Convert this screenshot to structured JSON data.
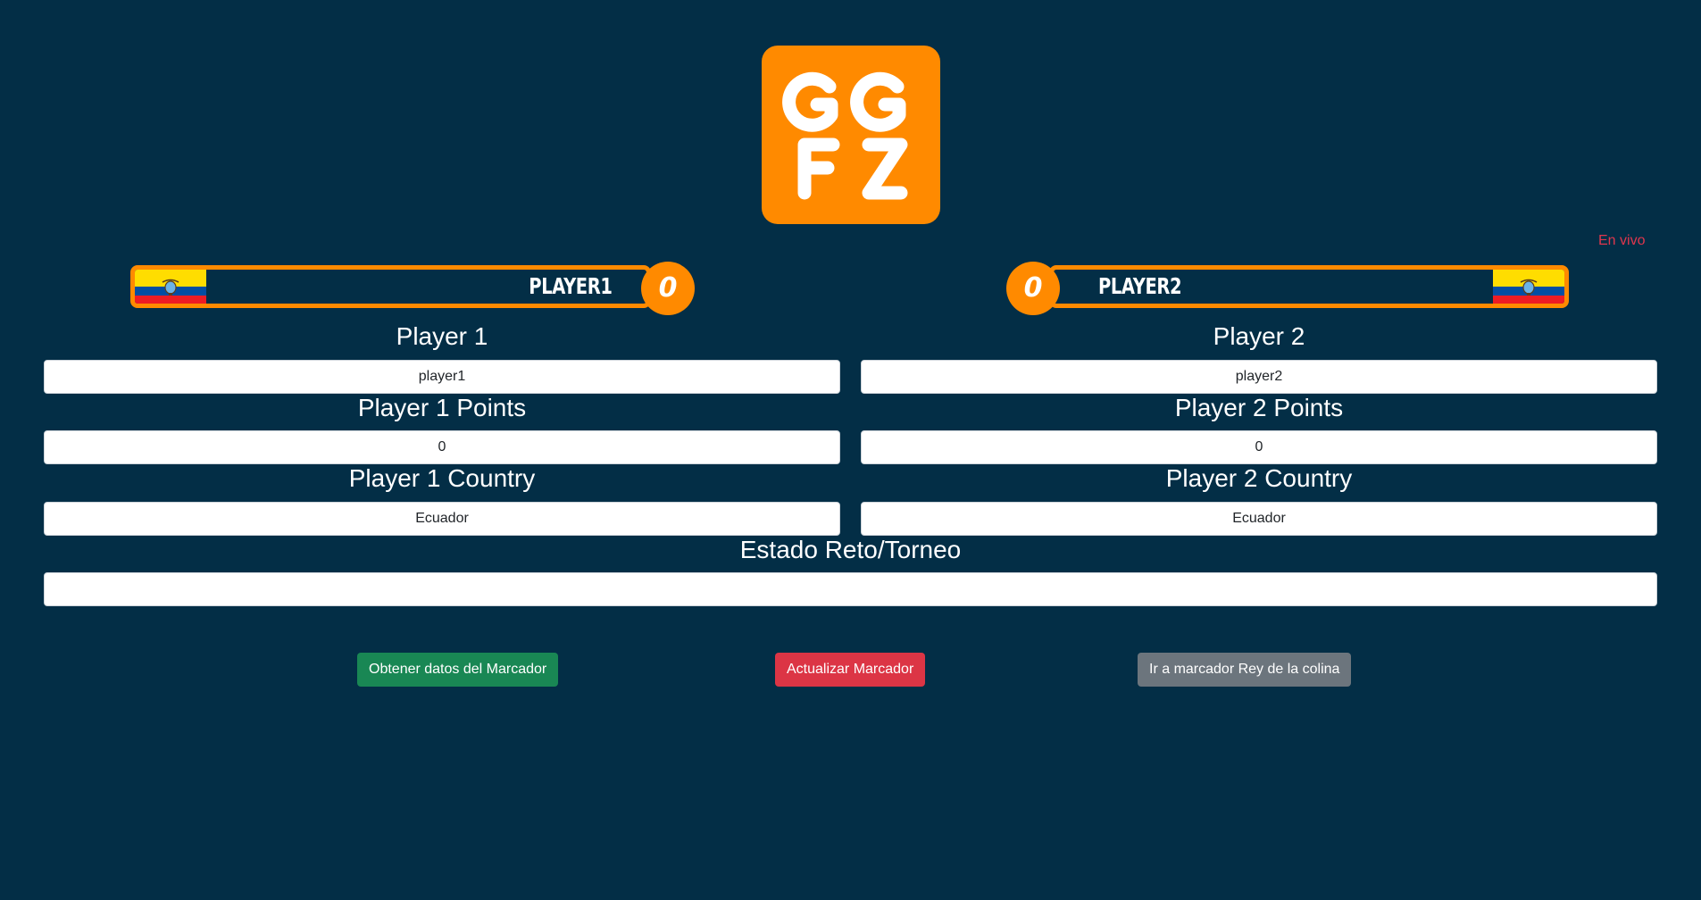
{
  "header": {
    "logo_text": "GGFZ",
    "live_label": "En vivo"
  },
  "scoreboard": {
    "player1": {
      "name": "PLAYER1",
      "score": "0",
      "flag": "ecuador-flag"
    },
    "player2": {
      "name": "PLAYER2",
      "score": "0",
      "flag": "ecuador-flag"
    },
    "colors": {
      "accent": "#ff8a00",
      "background": "#032e46"
    }
  },
  "form": {
    "player1_label": "Player 1",
    "player1_value": "player1",
    "player2_label": "Player 2",
    "player2_value": "player2",
    "player1_points_label": "Player 1 Points",
    "player1_points_value": "0",
    "player2_points_label": "Player 2 Points",
    "player2_points_value": "0",
    "player1_country_label": "Player 1 Country",
    "player1_country_value": "Ecuador",
    "player2_country_label": "Player 2 Country",
    "player2_country_value": "Ecuador",
    "status_label": "Estado Reto/Torneo",
    "status_value": ""
  },
  "actions": {
    "get_data_label": "Obtener datos del Marcador",
    "update_label": "Actualizar Marcador",
    "king_of_hill_label": "Ir a marcador Rey de la colina",
    "colors": {
      "get_data": "#198754",
      "update": "#dc3545",
      "king_of_hill": "#6c757d"
    }
  }
}
